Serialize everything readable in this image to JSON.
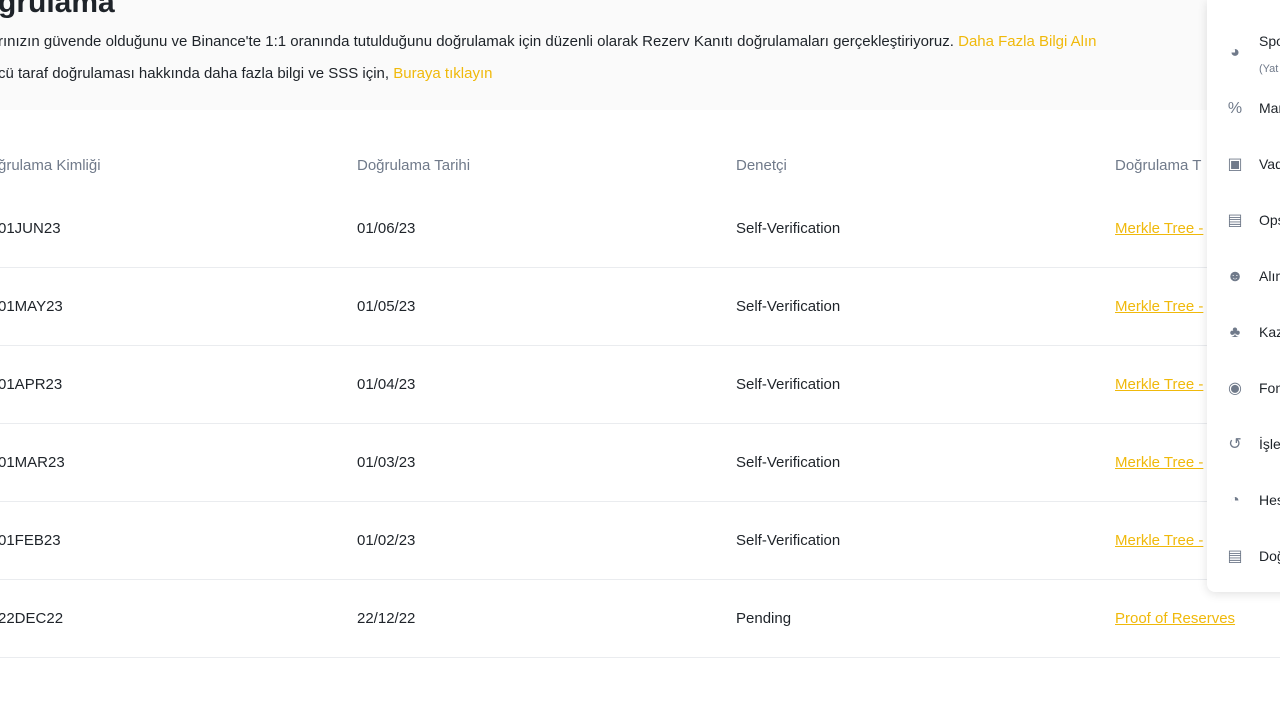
{
  "header": {
    "title": "ğrulama",
    "line1": "rınızın güvende olduğunu ve Binance'te 1:1 oranında tutulduğunu doğrulamak için düzenli olarak Rezerv Kanıtı doğrulamaları gerçekleştiriyoruz. ",
    "line1_link": "Daha Fazla Bilgi Alın",
    "line2": "cü taraf doğrulaması hakkında daha fazla bilgi ve SSS için, ",
    "line2_link": "Buraya tıklayın"
  },
  "table": {
    "headers": [
      "ğrulama Kimliği",
      "Doğrulama Tarihi",
      "Denetçi",
      "Doğrulama T"
    ],
    "rows": [
      [
        "01JUN23",
        "01/06/23",
        "Self-Verification",
        "Merkle Tree -"
      ],
      [
        "01MAY23",
        "01/05/23",
        "Self-Verification",
        "Merkle Tree -"
      ],
      [
        "01APR23",
        "01/04/23",
        "Self-Verification",
        "Merkle Tree -"
      ],
      [
        "01MAR23",
        "01/03/23",
        "Self-Verification",
        "Merkle Tree -"
      ],
      [
        "01FEB23",
        "01/02/23",
        "Self-Verification",
        "Merkle Tree -"
      ],
      [
        "22DEC22",
        "22/12/22",
        "Pending",
        "Proof of Reserves"
      ]
    ]
  },
  "menu": {
    "items": [
      {
        "label": "Spo",
        "sub": "(Yat",
        "icon": "spot-wallet-icon"
      },
      {
        "label": "Mar",
        "icon": "margin-percent-icon"
      },
      {
        "label": "Vad",
        "icon": "futures-icon"
      },
      {
        "label": "Ops",
        "icon": "options-icon"
      },
      {
        "label": "Alım",
        "icon": "bot-icon"
      },
      {
        "label": "Kaz",
        "icon": "earn-piggy-icon"
      },
      {
        "label": "Fon",
        "icon": "funding-icon"
      },
      {
        "label": "İşle",
        "icon": "transaction-history-icon"
      },
      {
        "label": "Hes",
        "icon": "account-pie-icon"
      },
      {
        "label": "Doğ",
        "icon": "document-icon"
      }
    ]
  },
  "colors": {
    "accent": "#f0b90b",
    "text": "#1e2329",
    "muted": "#707a8a"
  }
}
